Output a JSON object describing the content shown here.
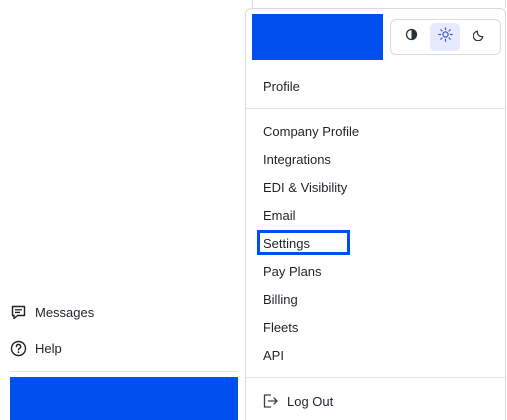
{
  "sidebar": {
    "messages_label": "Messages",
    "help_label": "Help"
  },
  "menu": {
    "theme_options": [
      "auto-contrast-icon",
      "light-sun-icon",
      "dark-moon-icon"
    ],
    "theme_selected": "light",
    "profile_label": "Profile",
    "items": [
      {
        "label": "Company Profile"
      },
      {
        "label": "Integrations"
      },
      {
        "label": "EDI & Visibility"
      },
      {
        "label": "Email"
      },
      {
        "label": "Settings"
      },
      {
        "label": "Pay Plans"
      },
      {
        "label": "Billing"
      },
      {
        "label": "Fleets"
      },
      {
        "label": "API"
      }
    ],
    "highlighted_item": "Settings",
    "logout_label": "Log Out"
  },
  "colors": {
    "accent": "#0050ef",
    "active_theme_bg": "#e6eafc",
    "border": "#d8dbe0"
  }
}
